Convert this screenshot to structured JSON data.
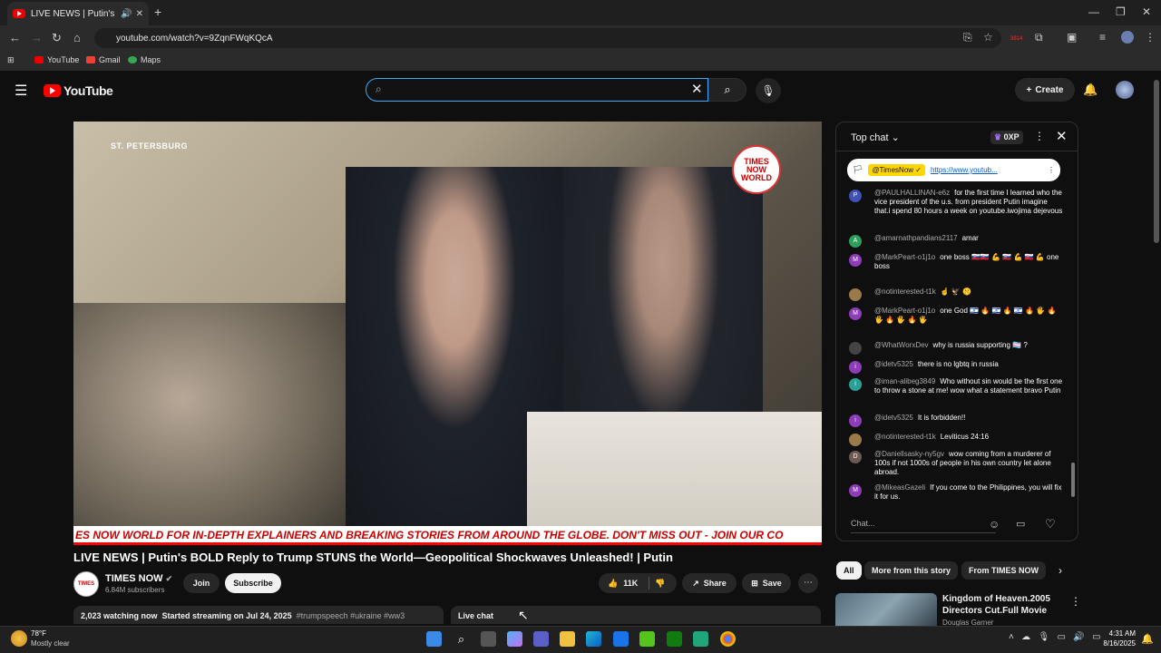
{
  "browser": {
    "tab_title": "LIVE NEWS | Putin's BOLD R",
    "url": "youtube.com/watch?v=9ZqnFWqKQcA",
    "bookmarks": [
      "YouTube",
      "Gmail",
      "Maps"
    ],
    "extension_badge": "3814"
  },
  "youtube_header": {
    "logo_text": "YouTube",
    "search_value": "",
    "create_label": "Create"
  },
  "video": {
    "location": "ST. PETERSBURG",
    "channel_badge": "TIMES NOW WORLD",
    "ticker": "ES NOW WORLD FOR IN-DEPTH EXPLAINERS AND BREAKING STORIES FROM AROUND THE GLOBE. DON'T MISS OUT - JOIN OUR CO",
    "title": "LIVE NEWS | Putin's BOLD Reply to Trump STUNS the World—Geopolitical Shockwaves Unleashed! | Putin",
    "channel_name": "TIMES NOW",
    "channel_avatar_text": "TIMES NOW",
    "subscribers": "6.84M subscribers",
    "join_label": "Join",
    "subscribe_label": "Subscribe",
    "likes": "11K",
    "share_label": "Share",
    "save_label": "Save",
    "watching": "2,023 watching now",
    "started": "Started streaming on Jul 24, 2025",
    "hashtags": "#trumpspeech #ukraine #ww3",
    "live_chat_label": "Live chat"
  },
  "chat": {
    "mode": "Top chat",
    "xp": "0XP",
    "pinned_author": "@TimesNow ✓",
    "pinned_link": "https://www.youtub...",
    "input_placeholder": "Chat...",
    "messages": [
      {
        "author": "@PAULHALLINAN-e6z",
        "text": "for the first time I learned who the vice president of the u.s. from president Putin imagine that.i spend 80 hours a week on youtube.iwojima dejevous",
        "initial": "P",
        "color": "#3f51b5"
      },
      {
        "author": "@amarnathpandians2117",
        "text": "amar",
        "initial": "A",
        "color": "#2e9e5b"
      },
      {
        "author": "@MarkPeart-o1j1o",
        "text": "one boss 🇸🇰🇸🇰 💪 🇸🇰 💪 🇸🇰 💪 one boss",
        "initial": "M",
        "color": "#8e3cb8"
      },
      {
        "author": "@notinterested-t1k",
        "text": "☝️ 🦅 🤫",
        "initial": "",
        "color": "#9b7a4a"
      },
      {
        "author": "@MarkPeart-o1j1o",
        "text": "one God 🇮🇱 🔥 🇮🇱 🔥 🇮🇱 🔥 🖐 🔥 🖐 🔥 🖐 🔥 🖐",
        "initial": "M",
        "color": "#8e3cb8"
      },
      {
        "author": "@WhatWorxDev",
        "text": "why is russia supporting 🏳️‍⚧️ ?",
        "initial": "",
        "color": "#444444"
      },
      {
        "author": "@idetv5325",
        "text": "there is no lgbtq in russia",
        "initial": "i",
        "color": "#8e3cb8"
      },
      {
        "author": "@iman-alibeg3849",
        "text": "Who without sin would be the first one to throw a stone at me! wow what a statement bravo Putin",
        "initial": "i",
        "color": "#2aa198"
      },
      {
        "author": "@idetv5325",
        "text": "It is forbidden!!",
        "initial": "i",
        "color": "#8e3cb8"
      },
      {
        "author": "@notinterested-t1k",
        "text": "Leviticus 24:16",
        "initial": "",
        "color": "#9b7a4a"
      },
      {
        "author": "@Daniellsasky-ny5gv",
        "text": "wow coming from a murderer of 100s if not 1000s of people in his own country let alone abroad.",
        "initial": "D",
        "color": "#6d5a52"
      },
      {
        "author": "@MikeasGazeli",
        "text": "If you come to the Philippines, you will fix it for us.",
        "initial": "M",
        "color": "#8e3cb8"
      }
    ]
  },
  "recommendations": {
    "chips": [
      "All",
      "More from this story",
      "From TIMES NOW"
    ],
    "first": {
      "title": "Kingdom of Heaven.2005 Directors Cut.Full Movie",
      "channel": "Douglas Garner"
    }
  },
  "taskbar": {
    "temperature": "78°F",
    "condition": "Mostly clear",
    "time": "4:31 AM",
    "date": "8/16/2025"
  }
}
